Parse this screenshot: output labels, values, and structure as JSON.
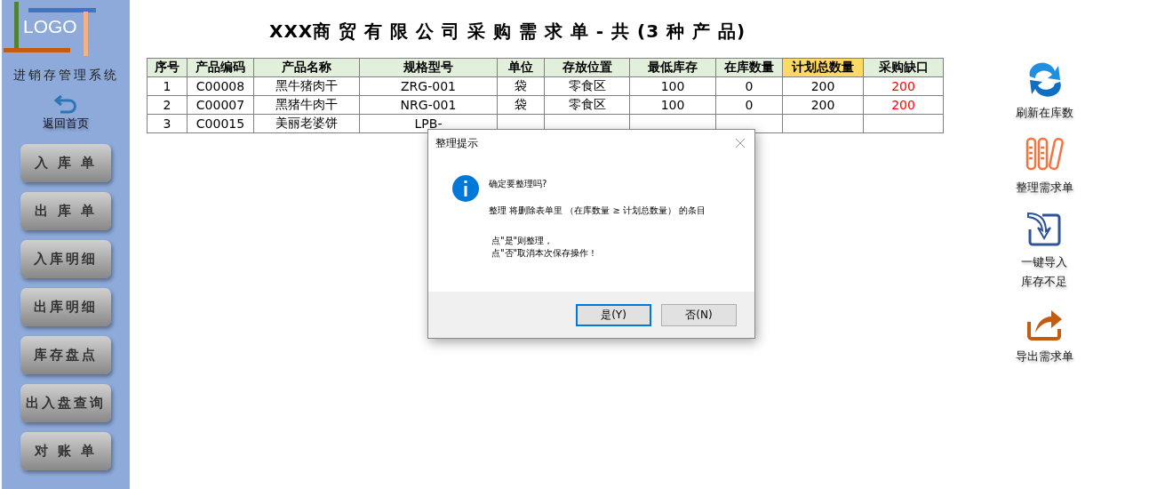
{
  "sidebar": {
    "logo": "LOGO",
    "app_name": "进销存管理系统",
    "back": "返回首页",
    "buttons": [
      "入 库 单",
      "出 库 单",
      "入库明细",
      "出库明细",
      "库存盘点",
      "出入盘查询",
      "对 账 单"
    ]
  },
  "title": "XXX商 贸 有 限 公 司 采 购 需 求 单 - 共 (3 种 产 品)",
  "table": {
    "columns": [
      {
        "label": "序号",
        "highlight": false,
        "alert": false
      },
      {
        "label": "产品编码",
        "highlight": false,
        "alert": false
      },
      {
        "label": "产品名称",
        "highlight": false,
        "alert": false
      },
      {
        "label": "规格型号",
        "highlight": false,
        "alert": false
      },
      {
        "label": "单位",
        "highlight": false,
        "alert": false
      },
      {
        "label": "存放位置",
        "highlight": false,
        "alert": false
      },
      {
        "label": "最低库存",
        "highlight": false,
        "alert": false
      },
      {
        "label": "在库数量",
        "highlight": false,
        "alert": false
      },
      {
        "label": "计划总数量",
        "highlight": true,
        "alert": false
      },
      {
        "label": "采购缺口",
        "highlight": false,
        "alert": true
      }
    ],
    "rows": [
      [
        "1",
        "C00008",
        "黑牛猪肉干",
        "ZRG-001",
        "袋",
        "零食区",
        "100",
        "0",
        "200",
        "200"
      ],
      [
        "2",
        "C00007",
        "黑猪牛肉干",
        "NRG-001",
        "袋",
        "零食区",
        "100",
        "0",
        "200",
        "200"
      ],
      [
        "3",
        "C00015",
        "美丽老婆饼",
        "LPB-"
      ]
    ]
  },
  "actions": [
    {
      "kind": "refresh",
      "lines": [
        "刷新在库数"
      ]
    },
    {
      "kind": "organize",
      "lines": [
        "整理需求单"
      ]
    },
    {
      "kind": "import",
      "lines": [
        "一键导入",
        "库存不足"
      ]
    },
    {
      "kind": "export",
      "lines": [
        "导出需求单"
      ]
    }
  ],
  "dialog": {
    "title": "整理提示",
    "question": "确定要整理吗?",
    "detail": "整理 将删除表单里 （在库数量 ≥ 计划总数量） 的条目",
    "hints": [
      "点\"是\"则整理，",
      "点\"否\"取消本次保存操作！"
    ],
    "buttons": [
      {
        "label": "是(Y)",
        "default": true
      },
      {
        "label": "否(N)",
        "default": false
      }
    ]
  }
}
